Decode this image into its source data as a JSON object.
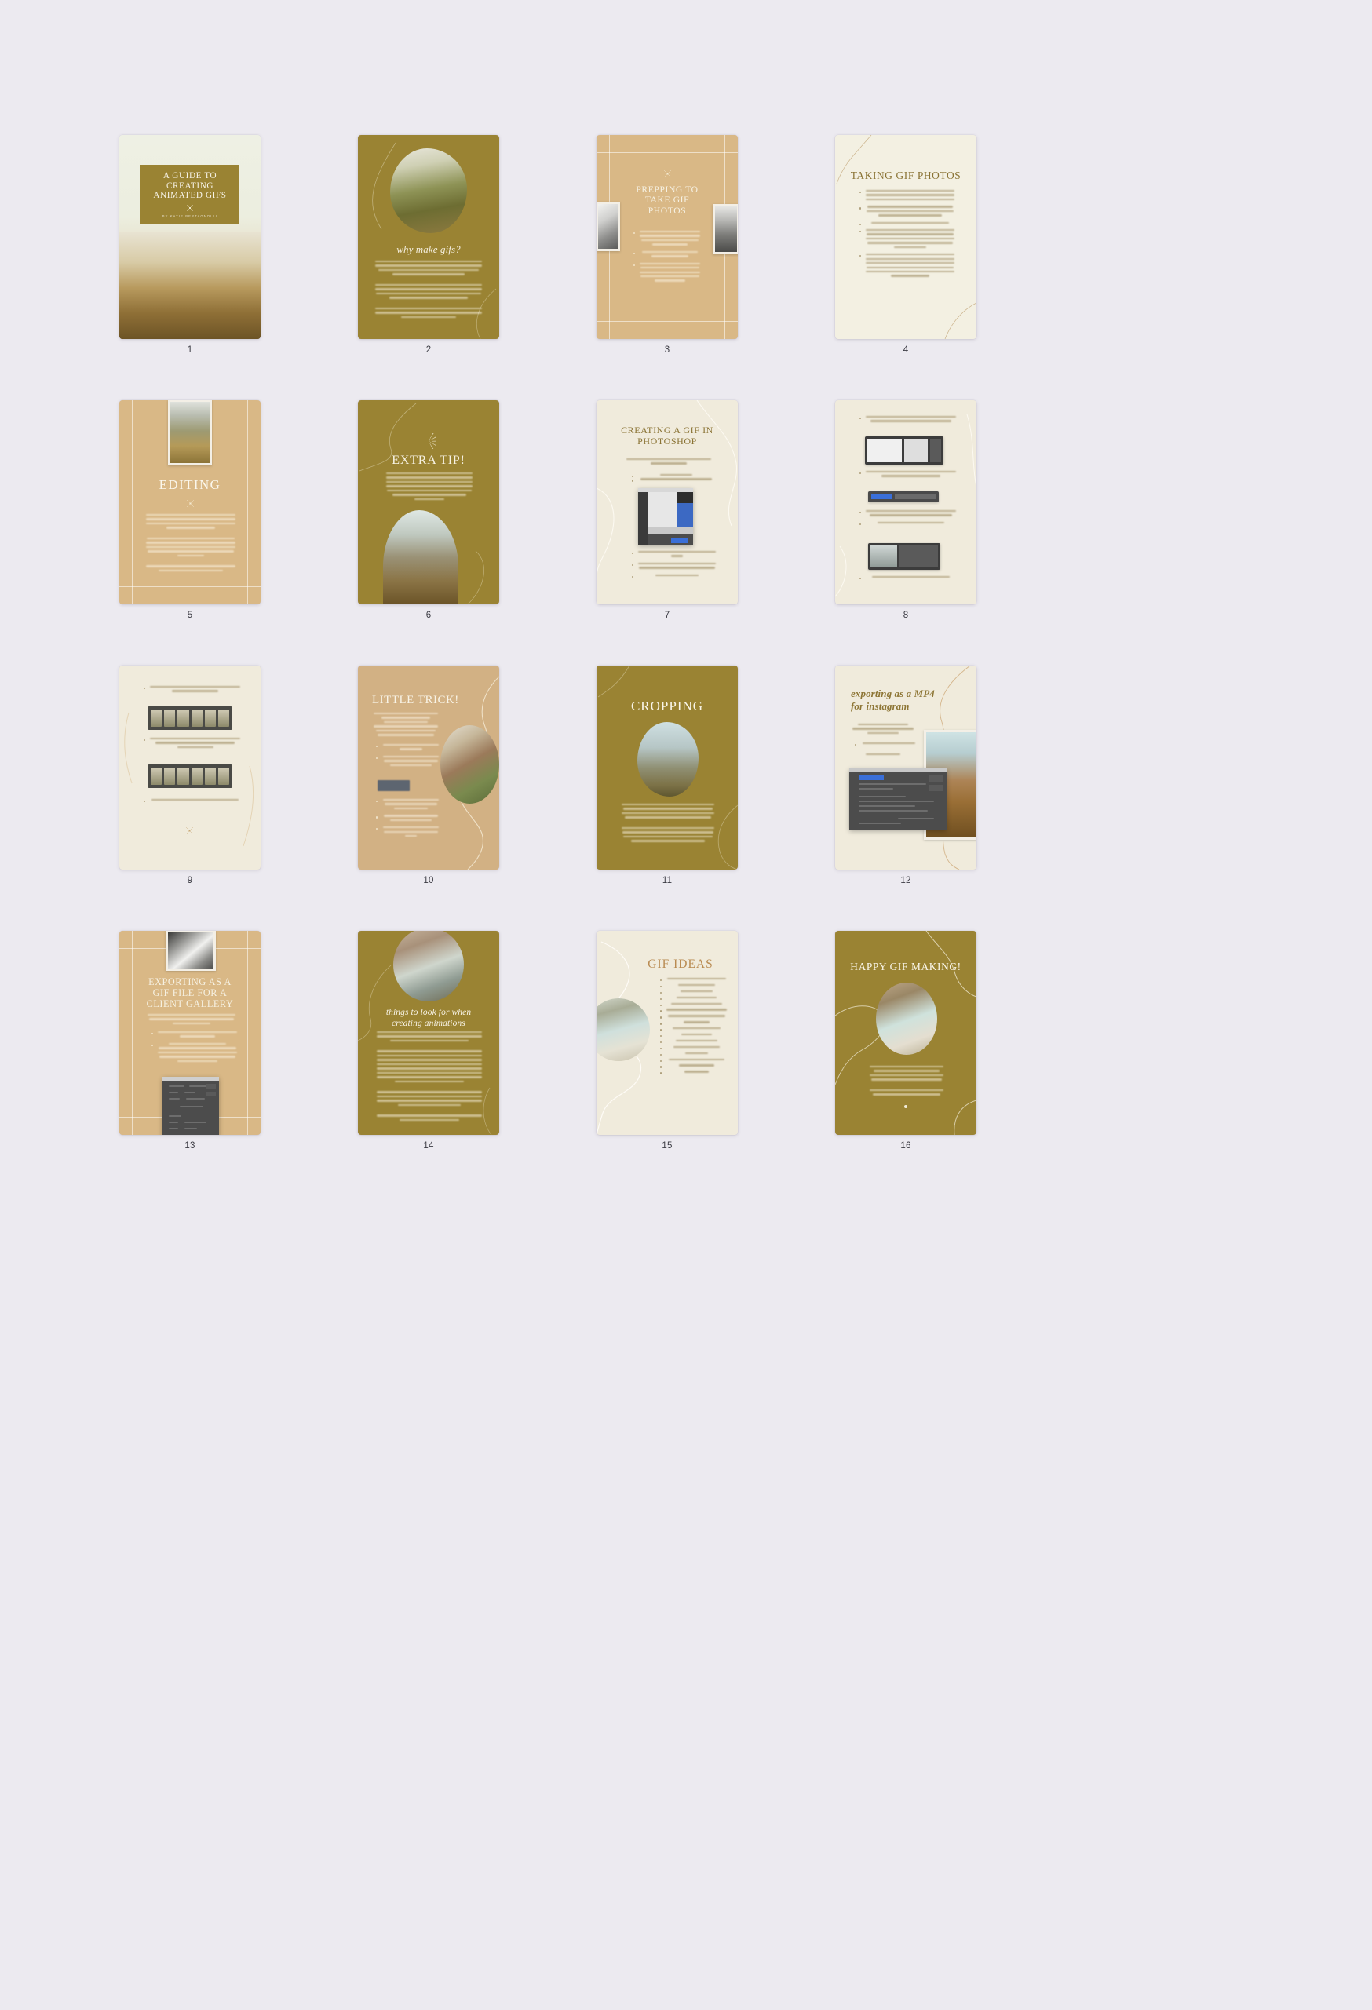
{
  "document": {
    "title": "A GUIDE TO CREATING ANIMATED GIFS",
    "author_line": "BY KATIE BERTAGNOLLI",
    "total_pages": 16,
    "background_color": "#eceaf0",
    "brand_colors": {
      "olive": "#9a8333",
      "tan": "#d9b886",
      "cream": "#f0ebdc",
      "ivory": "#f3f0e4",
      "gold_text": "#8a7334"
    }
  },
  "pages": [
    {
      "number": "1",
      "caption": "1",
      "theme": "cover",
      "title": "A GUIDE TO CREATING ANIMATED GIFS",
      "subtitle": "BY KATIE BERTAGNOLLI",
      "image_name": "desert-cactus-landscape-photo"
    },
    {
      "number": "2",
      "caption": "2",
      "theme": "olive",
      "title": "why make gifs?",
      "image_name": "palm-trees-couple-oval-photo"
    },
    {
      "number": "3",
      "caption": "3",
      "theme": "tan-grid",
      "title": "PREPPING TO TAKE GIF PHOTOS",
      "image_name": "black-and-white-couple-photos"
    },
    {
      "number": "4",
      "caption": "4",
      "theme": "ivory",
      "title": "TAKING GIF PHOTOS",
      "image_name": "none"
    },
    {
      "number": "5",
      "caption": "5",
      "theme": "tan-grid",
      "title": "EDITING",
      "image_name": "couple-running-field-photo"
    },
    {
      "number": "6",
      "caption": "6",
      "theme": "olive",
      "title": "EXTRA TIP!",
      "image_name": "couple-dancing-cliffside-photo"
    },
    {
      "number": "7",
      "caption": "7",
      "theme": "ivory",
      "title": "CREATING A GIF IN PHOTOSHOP",
      "image_name": "photoshop-load-files-dialog"
    },
    {
      "number": "8",
      "caption": "8",
      "theme": "ivory",
      "title": "",
      "image_name": "photoshop-layers-panel-screenshots"
    },
    {
      "number": "9",
      "caption": "9",
      "theme": "ivory",
      "title": "",
      "image_name": "photoshop-timeline-frames-screenshots"
    },
    {
      "number": "10",
      "caption": "10",
      "theme": "tan",
      "title": "LITTLE TRICK!",
      "image_name": "bridal-bouquet-oval-photo"
    },
    {
      "number": "11",
      "caption": "11",
      "theme": "olive",
      "title": "CROPPING",
      "image_name": "couple-cactus-oval-photo"
    },
    {
      "number": "12",
      "caption": "12",
      "theme": "ivory",
      "title": "exporting as a MP4 for instagram",
      "image_name": "desert-mesa-hikers-photo"
    },
    {
      "number": "13",
      "caption": "13",
      "theme": "tan-grid",
      "title": "EXPORTING AS A GIF FILE FOR A CLIENT GALLERY",
      "image_name": "black-and-white-veil-photo"
    },
    {
      "number": "14",
      "caption": "14",
      "theme": "olive",
      "title": "things to look for when creating animations",
      "image_name": "couple-embracing-oval-photo"
    },
    {
      "number": "15",
      "caption": "15",
      "theme": "ivory",
      "title": "GIF IDEAS",
      "image_name": "coastal-beach-circle-photo"
    },
    {
      "number": "16",
      "caption": "16",
      "theme": "olive",
      "title": "HAPPY GIF MAKING!",
      "image_name": "couple-on-beach-oval-photo"
    }
  ]
}
